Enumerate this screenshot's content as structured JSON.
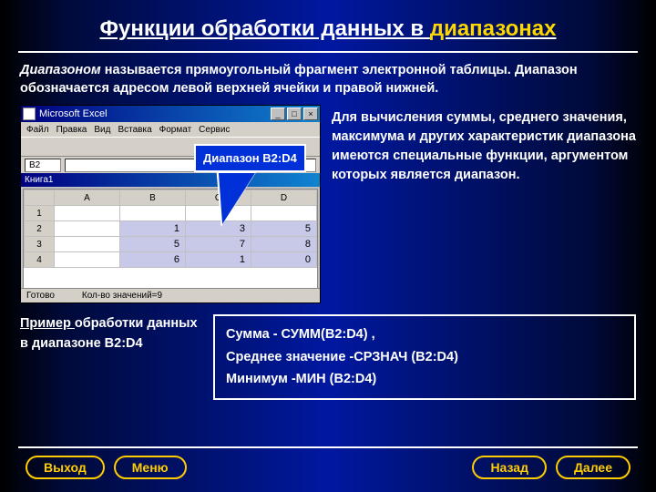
{
  "title": {
    "part1": "Функции обработки данных в ",
    "part2": "диапазонах"
  },
  "intro": {
    "em": "Диапазоном ",
    "rest": "называется прямоугольный фрагмент электронной таблицы. Диапазон обозначается адресом левой верхней ячейки и правой нижней."
  },
  "callout": "Диапазон B2:D4",
  "excel": {
    "app": "Microsoft Excel",
    "menu": [
      "Файл",
      "Правка",
      "Вид",
      "Вставка",
      "Формат",
      "Сервис"
    ],
    "book": "Книга1",
    "cellref": "B2",
    "cols": [
      "",
      "A",
      "B",
      "C",
      "D"
    ],
    "rows": [
      {
        "h": "1",
        "c": [
          "",
          "",
          "",
          ""
        ]
      },
      {
        "h": "2",
        "c": [
          "",
          "1",
          "3",
          "5"
        ]
      },
      {
        "h": "3",
        "c": [
          "",
          "5",
          "7",
          "8"
        ]
      },
      {
        "h": "4",
        "c": [
          "",
          "6",
          "1",
          "0"
        ]
      }
    ],
    "status1": "Готово",
    "status2": "Кол-во значений=9"
  },
  "right": "Для вычисления суммы, среднего значения, максимума и других характеристик  диапазона имеются специальные функции, аргументом которых является  диапазон.",
  "example": {
    "und": "Пример ",
    "rest": "обработки данных в диапазоне B2:D4"
  },
  "formulas": {
    "l1": "Сумма  -   СУММ(B2:D4) ,",
    "l2": "Среднее значение -СРЗНАЧ (B2:D4)",
    "l3": "Минимум -МИН (B2:D4)"
  },
  "nav": {
    "exit": "Выход",
    "menu": "Меню",
    "back": "Назад",
    "next": "Далее"
  }
}
